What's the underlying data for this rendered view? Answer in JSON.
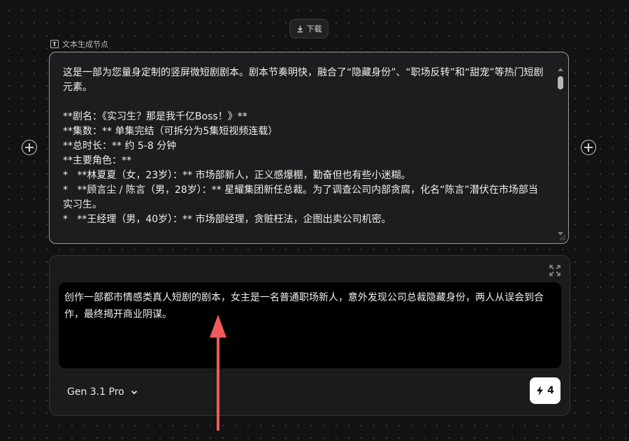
{
  "toolbar": {
    "download_label": "下载"
  },
  "text_node": {
    "label": "文本生成节点",
    "lines": [
      "这是一部为您量身定制的竖屏微短剧剧本。剧本节奏明快，融合了“隐藏身份”、“职场反转”和“甜宠”等热门短剧",
      "元素。",
      "",
      "**剧名：《实习生？那是我千亿Boss！》**",
      "**集数：** 单集完结（可拆分为5集短视频连载）",
      "**总时长：** 约 5-8 分钟",
      "**主要角色：**",
      "*   **林夏夏（女，23岁）：** 市场部新人，正义感爆棚，勤奋但也有些小迷糊。",
      "*   **顾言尘 / 陈言（男，28岁）：** 星耀集团新任总裁。为了调查公司内部贪腐，化名“陈言”潜伏在市场部当",
      "实习生。",
      "*   **王经理（男，40岁）：** 市场部经理，贪赃枉法，企图出卖公司机密。"
    ]
  },
  "prompt": {
    "text": "创作一部都市情感类真人短剧的剧本，女主是一名普通职场新人，意外发现公司总裁隐藏身份，两人从误会到合作，最终揭开商业阴谋。",
    "model": "Gen 3.1 Pro",
    "credits": "4"
  },
  "colors": {
    "background": "#121212",
    "annotation_arrow": "#f05a5a",
    "node_border": "#9a9a9a"
  }
}
